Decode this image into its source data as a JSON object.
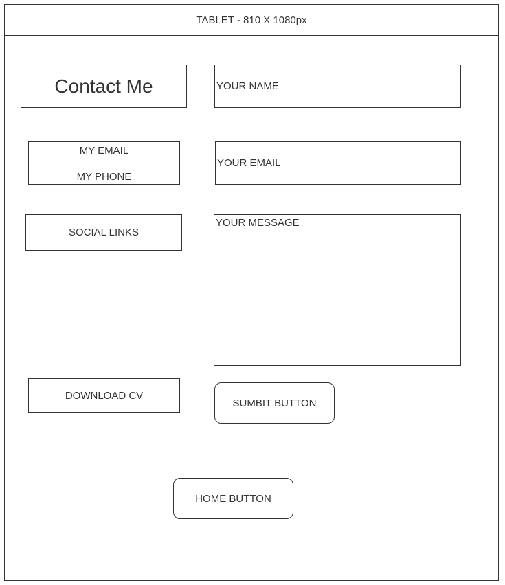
{
  "header": {
    "title": "TABLET - 810 X 1080px"
  },
  "left_column": {
    "title": "Contact Me",
    "contact_info": {
      "email": "MY EMAIL",
      "phone": "MY PHONE"
    },
    "social": "SOCIAL LINKS",
    "download": "DOWNLOAD CV"
  },
  "form": {
    "name_placeholder": "YOUR NAME",
    "email_placeholder": "YOUR EMAIL",
    "message_placeholder": "YOUR MESSAGE",
    "submit_label": "SUMBIT BUTTON"
  },
  "home_label": "HOME BUTTON"
}
